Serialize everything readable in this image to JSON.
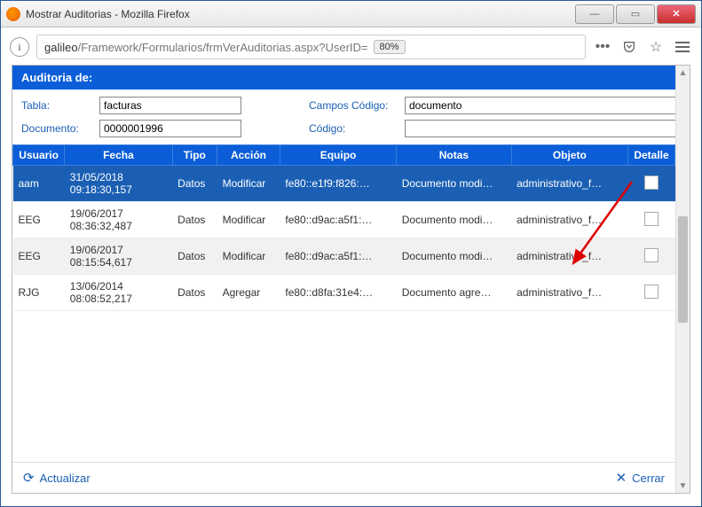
{
  "window": {
    "title": "Mostrar Auditorias - Mozilla Firefox"
  },
  "url": {
    "host": "galileo",
    "path": "/Framework/Formularios/frmVerAuditorias.aspx?UserID=",
    "zoom": "80%"
  },
  "header": {
    "title": "Auditoria de:"
  },
  "form": {
    "tabla_label": "Tabla:",
    "tabla_value": "facturas",
    "campos_codigo_label": "Campos Código:",
    "campos_codigo_value": "documento",
    "documento_label": "Documento:",
    "documento_value": "0000001996",
    "codigo_label": "Código:",
    "codigo_value": ""
  },
  "table": {
    "columns": {
      "usuario": "Usuario",
      "fecha": "Fecha",
      "tipo": "Tipo",
      "accion": "Acción",
      "equipo": "Equipo",
      "notas": "Notas",
      "objeto": "Objeto",
      "detalle": "Detalle"
    },
    "rows": [
      {
        "usuario": "aam",
        "fecha": "31/05/2018 09:18:30,157",
        "tipo": "Datos",
        "accion": "Modificar",
        "equipo": "fe80::e1f9:f826:…",
        "notas": "Documento modi…",
        "objeto": "administrativo_f…"
      },
      {
        "usuario": "EEG",
        "fecha": "19/06/2017 08:36:32,487",
        "tipo": "Datos",
        "accion": "Modificar",
        "equipo": "fe80::d9ac:a5f1:…",
        "notas": "Documento modi…",
        "objeto": "administrativo_f…"
      },
      {
        "usuario": "EEG",
        "fecha": "19/06/2017 08:15:54,617",
        "tipo": "Datos",
        "accion": "Modificar",
        "equipo": "fe80::d9ac:a5f1:…",
        "notas": "Documento modi…",
        "objeto": "administrativo_f…"
      },
      {
        "usuario": "RJG",
        "fecha": "13/06/2014 08:08:52,217",
        "tipo": "Datos",
        "accion": "Agregar",
        "equipo": "fe80::d8fa:31e4:…",
        "notas": "Documento agre…",
        "objeto": "administrativo_f…"
      }
    ]
  },
  "footer": {
    "refresh": "Actualizar",
    "close": "Cerrar"
  }
}
